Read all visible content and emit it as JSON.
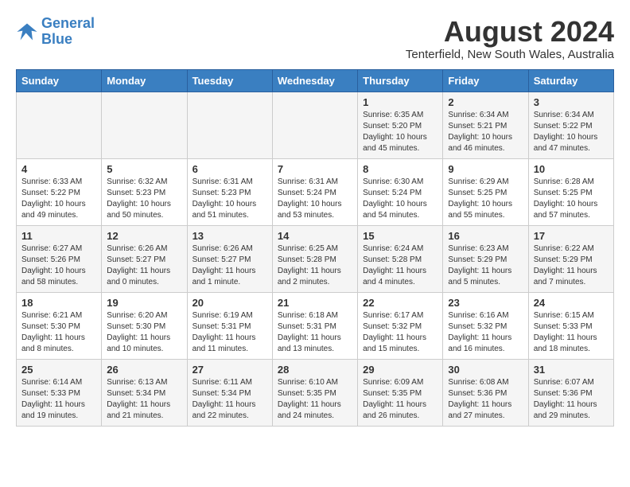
{
  "logo": {
    "line1": "General",
    "line2": "Blue"
  },
  "title": "August 2024",
  "subtitle": "Tenterfield, New South Wales, Australia",
  "days_of_week": [
    "Sunday",
    "Monday",
    "Tuesday",
    "Wednesday",
    "Thursday",
    "Friday",
    "Saturday"
  ],
  "weeks": [
    [
      {
        "day": "",
        "info": ""
      },
      {
        "day": "",
        "info": ""
      },
      {
        "day": "",
        "info": ""
      },
      {
        "day": "",
        "info": ""
      },
      {
        "day": "1",
        "info": "Sunrise: 6:35 AM\nSunset: 5:20 PM\nDaylight: 10 hours\nand 45 minutes."
      },
      {
        "day": "2",
        "info": "Sunrise: 6:34 AM\nSunset: 5:21 PM\nDaylight: 10 hours\nand 46 minutes."
      },
      {
        "day": "3",
        "info": "Sunrise: 6:34 AM\nSunset: 5:22 PM\nDaylight: 10 hours\nand 47 minutes."
      }
    ],
    [
      {
        "day": "4",
        "info": "Sunrise: 6:33 AM\nSunset: 5:22 PM\nDaylight: 10 hours\nand 49 minutes."
      },
      {
        "day": "5",
        "info": "Sunrise: 6:32 AM\nSunset: 5:23 PM\nDaylight: 10 hours\nand 50 minutes."
      },
      {
        "day": "6",
        "info": "Sunrise: 6:31 AM\nSunset: 5:23 PM\nDaylight: 10 hours\nand 51 minutes."
      },
      {
        "day": "7",
        "info": "Sunrise: 6:31 AM\nSunset: 5:24 PM\nDaylight: 10 hours\nand 53 minutes."
      },
      {
        "day": "8",
        "info": "Sunrise: 6:30 AM\nSunset: 5:24 PM\nDaylight: 10 hours\nand 54 minutes."
      },
      {
        "day": "9",
        "info": "Sunrise: 6:29 AM\nSunset: 5:25 PM\nDaylight: 10 hours\nand 55 minutes."
      },
      {
        "day": "10",
        "info": "Sunrise: 6:28 AM\nSunset: 5:25 PM\nDaylight: 10 hours\nand 57 minutes."
      }
    ],
    [
      {
        "day": "11",
        "info": "Sunrise: 6:27 AM\nSunset: 5:26 PM\nDaylight: 10 hours\nand 58 minutes."
      },
      {
        "day": "12",
        "info": "Sunrise: 6:26 AM\nSunset: 5:27 PM\nDaylight: 11 hours\nand 0 minutes."
      },
      {
        "day": "13",
        "info": "Sunrise: 6:26 AM\nSunset: 5:27 PM\nDaylight: 11 hours\nand 1 minute."
      },
      {
        "day": "14",
        "info": "Sunrise: 6:25 AM\nSunset: 5:28 PM\nDaylight: 11 hours\nand 2 minutes."
      },
      {
        "day": "15",
        "info": "Sunrise: 6:24 AM\nSunset: 5:28 PM\nDaylight: 11 hours\nand 4 minutes."
      },
      {
        "day": "16",
        "info": "Sunrise: 6:23 AM\nSunset: 5:29 PM\nDaylight: 11 hours\nand 5 minutes."
      },
      {
        "day": "17",
        "info": "Sunrise: 6:22 AM\nSunset: 5:29 PM\nDaylight: 11 hours\nand 7 minutes."
      }
    ],
    [
      {
        "day": "18",
        "info": "Sunrise: 6:21 AM\nSunset: 5:30 PM\nDaylight: 11 hours\nand 8 minutes."
      },
      {
        "day": "19",
        "info": "Sunrise: 6:20 AM\nSunset: 5:30 PM\nDaylight: 11 hours\nand 10 minutes."
      },
      {
        "day": "20",
        "info": "Sunrise: 6:19 AM\nSunset: 5:31 PM\nDaylight: 11 hours\nand 11 minutes."
      },
      {
        "day": "21",
        "info": "Sunrise: 6:18 AM\nSunset: 5:31 PM\nDaylight: 11 hours\nand 13 minutes."
      },
      {
        "day": "22",
        "info": "Sunrise: 6:17 AM\nSunset: 5:32 PM\nDaylight: 11 hours\nand 15 minutes."
      },
      {
        "day": "23",
        "info": "Sunrise: 6:16 AM\nSunset: 5:32 PM\nDaylight: 11 hours\nand 16 minutes."
      },
      {
        "day": "24",
        "info": "Sunrise: 6:15 AM\nSunset: 5:33 PM\nDaylight: 11 hours\nand 18 minutes."
      }
    ],
    [
      {
        "day": "25",
        "info": "Sunrise: 6:14 AM\nSunset: 5:33 PM\nDaylight: 11 hours\nand 19 minutes."
      },
      {
        "day": "26",
        "info": "Sunrise: 6:13 AM\nSunset: 5:34 PM\nDaylight: 11 hours\nand 21 minutes."
      },
      {
        "day": "27",
        "info": "Sunrise: 6:11 AM\nSunset: 5:34 PM\nDaylight: 11 hours\nand 22 minutes."
      },
      {
        "day": "28",
        "info": "Sunrise: 6:10 AM\nSunset: 5:35 PM\nDaylight: 11 hours\nand 24 minutes."
      },
      {
        "day": "29",
        "info": "Sunrise: 6:09 AM\nSunset: 5:35 PM\nDaylight: 11 hours\nand 26 minutes."
      },
      {
        "day": "30",
        "info": "Sunrise: 6:08 AM\nSunset: 5:36 PM\nDaylight: 11 hours\nand 27 minutes."
      },
      {
        "day": "31",
        "info": "Sunrise: 6:07 AM\nSunset: 5:36 PM\nDaylight: 11 hours\nand 29 minutes."
      }
    ]
  ]
}
